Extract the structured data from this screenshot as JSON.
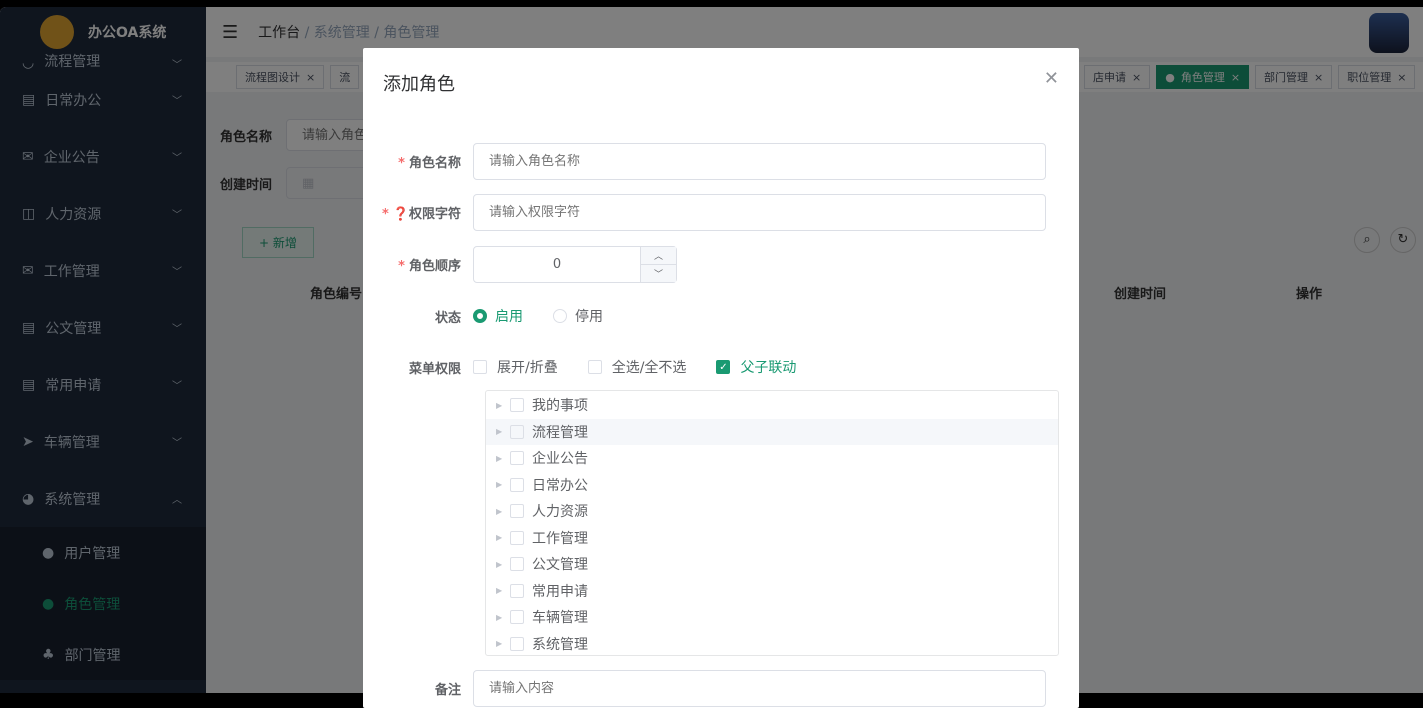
{
  "app": {
    "title": "办公OA系统"
  },
  "sidebar": {
    "items": [
      {
        "label": "流程管理",
        "icon": "flow-icon"
      },
      {
        "label": "日常办公",
        "icon": "doc-icon"
      },
      {
        "label": "企业公告",
        "icon": "mail-icon"
      },
      {
        "label": "人力资源",
        "icon": "book-icon"
      },
      {
        "label": "工作管理",
        "icon": "mail-icon"
      },
      {
        "label": "公文管理",
        "icon": "doc-icon"
      },
      {
        "label": "常用申请",
        "icon": "doc-icon"
      },
      {
        "label": "车辆管理",
        "icon": "send-icon"
      },
      {
        "label": "系统管理",
        "icon": "dashboard-icon"
      }
    ],
    "subitems": [
      {
        "label": "用户管理"
      },
      {
        "label": "角色管理"
      },
      {
        "label": "部门管理"
      }
    ]
  },
  "header": {
    "breadcrumb": [
      "工作台",
      "系统管理",
      "角色管理"
    ]
  },
  "tags": [
    "流程图设计",
    "流",
    "店申请",
    "角色管理",
    "部门管理",
    "职位管理"
  ],
  "search": {
    "role_name_label": "角色名称",
    "role_name_placeholder": "请输入角色名称",
    "created_label": "创建时间"
  },
  "toolbar": {
    "add_label": "+ 新增"
  },
  "table": {
    "columns": [
      "角色编号",
      "创建时间",
      "操作"
    ]
  },
  "modal": {
    "title": "添加角色",
    "role_name": {
      "label": "角色名称",
      "placeholder": "请输入角色名称"
    },
    "perm": {
      "label": "权限字符",
      "placeholder": "请输入权限字符"
    },
    "order": {
      "label": "角色顺序",
      "value": "0"
    },
    "status": {
      "label": "状态",
      "options": [
        "启用",
        "停用"
      ],
      "selected": "启用"
    },
    "menu": {
      "label": "菜单权限",
      "options": [
        "展开/折叠",
        "全选/全不选",
        "父子联动"
      ],
      "tree": [
        "我的事项",
        "流程管理",
        "企业公告",
        "日常办公",
        "人力资源",
        "工作管理",
        "公文管理",
        "常用申请",
        "车辆管理",
        "系统管理"
      ]
    },
    "remark": {
      "label": "备注",
      "placeholder": "请输入内容"
    }
  },
  "colors": {
    "accent": "#1a9a72",
    "sidebar": "#1f2a3c"
  }
}
